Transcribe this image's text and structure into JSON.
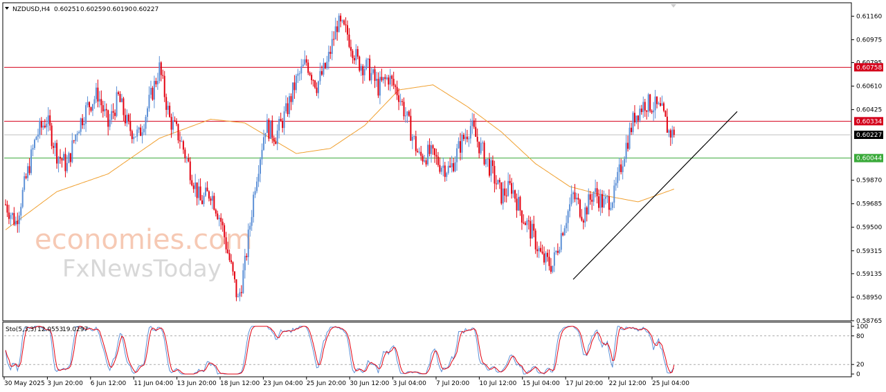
{
  "header": {
    "dropdown_icon": "triangle-down-icon",
    "symbol": "NZDUSD,H4",
    "open": "0.60251",
    "high": "0.60259",
    "low": "0.60190",
    "close": "0.60227"
  },
  "indicator": {
    "name": "Sto(5,3,3)",
    "main": "12.0553",
    "signal": "19.0297"
  },
  "watermark": {
    "line1": "economies.com",
    "line2": "FxNewsToday"
  },
  "colors": {
    "bull": "#5b8fd6",
    "bear": "#e3000f",
    "ma": "#f0a030",
    "red_level": "#d4001a",
    "green_level": "#3aaa3a",
    "current_price_bg": "#000000",
    "stoch_main": "#5b8fd6",
    "stoch_signal": "#e3000f"
  },
  "chart_data": {
    "type": "candlestick",
    "symbol": "NZDUSD",
    "timeframe": "H4",
    "ylim": [
      0.5877,
      0.6126
    ],
    "y_ticks": [
      "0.61160",
      "0.60975",
      "0.60795",
      "0.60610",
      "0.60425",
      "0.59870",
      "0.59685",
      "0.59500",
      "0.59315",
      "0.59135",
      "0.58950",
      "0.58765"
    ],
    "x_ticks": [
      "30 May 2025",
      "3 Jun 20:00",
      "6 Jun 12:00",
      "11 Jun 04:00",
      "13 Jun 20:00",
      "18 Jun 12:00",
      "23 Jun 04:00",
      "25 Jun 20:00",
      "30 Jun 12:00",
      "3 Jul 04:00",
      "7 Jul 20:00",
      "10 Jul 12:00",
      "15 Jul 04:00",
      "17 Jul 20:00",
      "22 Jul 12:00",
      "25 Jul 04:00"
    ],
    "levels": [
      {
        "label": "0.60758",
        "value": 0.60758,
        "color": "red"
      },
      {
        "label": "0.60334",
        "value": 0.60334,
        "color": "red"
      },
      {
        "label": "0.60044",
        "value": 0.60044,
        "color": "green"
      }
    ],
    "current_price": {
      "label": "0.60227",
      "value": 0.60227
    },
    "trendline": [
      [
        0.5909,
        0.6041
      ]
    ],
    "price_path": [
      [
        0,
        0.5968
      ],
      [
        6,
        0.5954
      ],
      [
        12,
        0.5988
      ],
      [
        18,
        0.6022
      ],
      [
        24,
        0.6035
      ],
      [
        30,
        0.6008
      ],
      [
        36,
        0.5998
      ],
      [
        42,
        0.6028
      ],
      [
        48,
        0.6045
      ],
      [
        54,
        0.6055
      ],
      [
        60,
        0.603
      ],
      [
        66,
        0.6052
      ],
      [
        72,
        0.6028
      ],
      [
        78,
        0.6022
      ],
      [
        84,
        0.6048
      ],
      [
        90,
        0.6075
      ],
      [
        96,
        0.6035
      ],
      [
        102,
        0.602
      ],
      [
        108,
        0.5995
      ],
      [
        114,
        0.597
      ],
      [
        120,
        0.5978
      ],
      [
        126,
        0.5955
      ],
      [
        132,
        0.5918
      ],
      [
        136,
        0.5892
      ],
      [
        140,
        0.592
      ],
      [
        146,
        0.5985
      ],
      [
        152,
        0.603
      ],
      [
        158,
        0.6022
      ],
      [
        164,
        0.604
      ],
      [
        170,
        0.6065
      ],
      [
        176,
        0.608
      ],
      [
        182,
        0.6062
      ],
      [
        188,
        0.6078
      ],
      [
        194,
        0.611
      ],
      [
        200,
        0.6102
      ],
      [
        206,
        0.608
      ],
      [
        212,
        0.6075
      ],
      [
        218,
        0.606
      ],
      [
        224,
        0.6068
      ],
      [
        230,
        0.6055
      ],
      [
        236,
        0.603
      ],
      [
        242,
        0.6005
      ],
      [
        248,
        0.6008
      ],
      [
        254,
        0.6
      ],
      [
        260,
        0.5995
      ],
      [
        266,
        0.6015
      ],
      [
        272,
        0.603
      ],
      [
        278,
        0.6012
      ],
      [
        284,
        0.5995
      ],
      [
        290,
        0.5975
      ],
      [
        296,
        0.5982
      ],
      [
        302,
        0.596
      ],
      [
        308,
        0.5945
      ],
      [
        314,
        0.5925
      ],
      [
        320,
        0.592
      ],
      [
        326,
        0.595
      ],
      [
        332,
        0.5975
      ],
      [
        338,
        0.596
      ],
      [
        344,
        0.5978
      ],
      [
        350,
        0.5968
      ],
      [
        356,
        0.5975
      ],
      [
        362,
        0.601
      ],
      [
        368,
        0.6038
      ],
      [
        374,
        0.6048
      ],
      [
        380,
        0.6045
      ],
      [
        384,
        0.604
      ],
      [
        388,
        0.6025
      ],
      [
        391,
        0.60227
      ]
    ],
    "ma_path": [
      [
        0,
        0.5948
      ],
      [
        30,
        0.5978
      ],
      [
        60,
        0.5992
      ],
      [
        90,
        0.602
      ],
      [
        120,
        0.6035
      ],
      [
        140,
        0.6032
      ],
      [
        170,
        0.6008
      ],
      [
        190,
        0.6012
      ],
      [
        210,
        0.603
      ],
      [
        230,
        0.6058
      ],
      [
        250,
        0.6062
      ],
      [
        270,
        0.6045
      ],
      [
        290,
        0.6025
      ],
      [
        310,
        0.6
      ],
      [
        330,
        0.5982
      ],
      [
        350,
        0.5975
      ],
      [
        370,
        0.597
      ],
      [
        391,
        0.598
      ]
    ],
    "stochastic": {
      "name": "Sto(5,3,3)",
      "main_last": 12.0553,
      "signal_last": 19.0297,
      "levels": [
        80,
        20
      ],
      "y_ticks": [
        "100",
        "80",
        "20",
        "0"
      ]
    }
  }
}
